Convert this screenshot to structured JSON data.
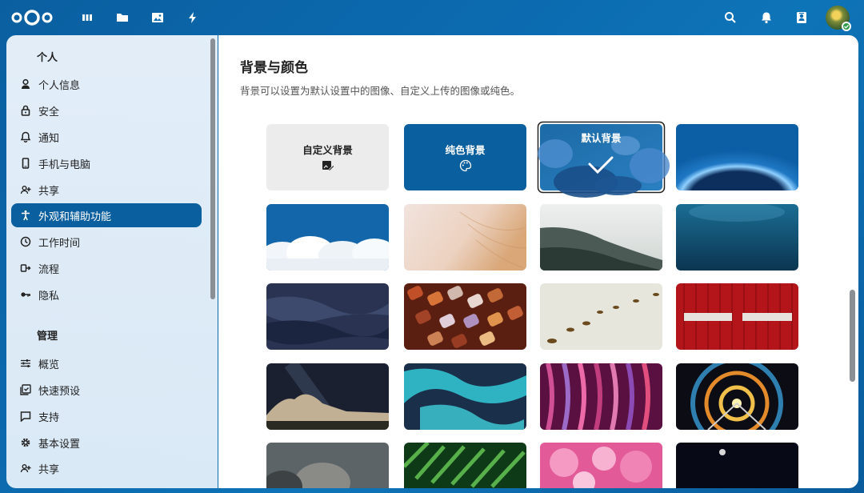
{
  "topbar": {
    "apps": [
      "dashboard-icon",
      "files-icon",
      "photos-icon",
      "activity-icon"
    ],
    "right": [
      "search-icon",
      "bell-icon",
      "contacts-icon"
    ]
  },
  "sidebar": {
    "personal_title": "个人",
    "personal_items": [
      {
        "label": "个人信息",
        "icon": "user-icon"
      },
      {
        "label": "安全",
        "icon": "lock-icon"
      },
      {
        "label": "通知",
        "icon": "bell-icon"
      },
      {
        "label": "手机与电脑",
        "icon": "phone-icon"
      },
      {
        "label": "共享",
        "icon": "share-icon"
      },
      {
        "label": "外观和辅助功能",
        "icon": "accessibility-icon",
        "active": true
      },
      {
        "label": "工作时间",
        "icon": "clock-icon"
      },
      {
        "label": "流程",
        "icon": "flow-icon"
      },
      {
        "label": "隐私",
        "icon": "key-icon"
      }
    ],
    "admin_title": "管理",
    "admin_items": [
      {
        "label": "概览",
        "icon": "sliders-icon"
      },
      {
        "label": "快速预设",
        "icon": "checklist-icon"
      },
      {
        "label": "支持",
        "icon": "chat-icon"
      },
      {
        "label": "基本设置",
        "icon": "gear-icon"
      },
      {
        "label": "共享",
        "icon": "share-icon"
      }
    ]
  },
  "main": {
    "title": "背景与颜色",
    "description": "背景可以设置为默认设置中的图像、自定义上传的图像或纯色。",
    "custom_label": "自定义背景",
    "plain_label": "纯色背景",
    "default_label": "默认背景"
  },
  "colors": {
    "primary": "#0a5f9e",
    "topbar": "#0c6bb0"
  }
}
